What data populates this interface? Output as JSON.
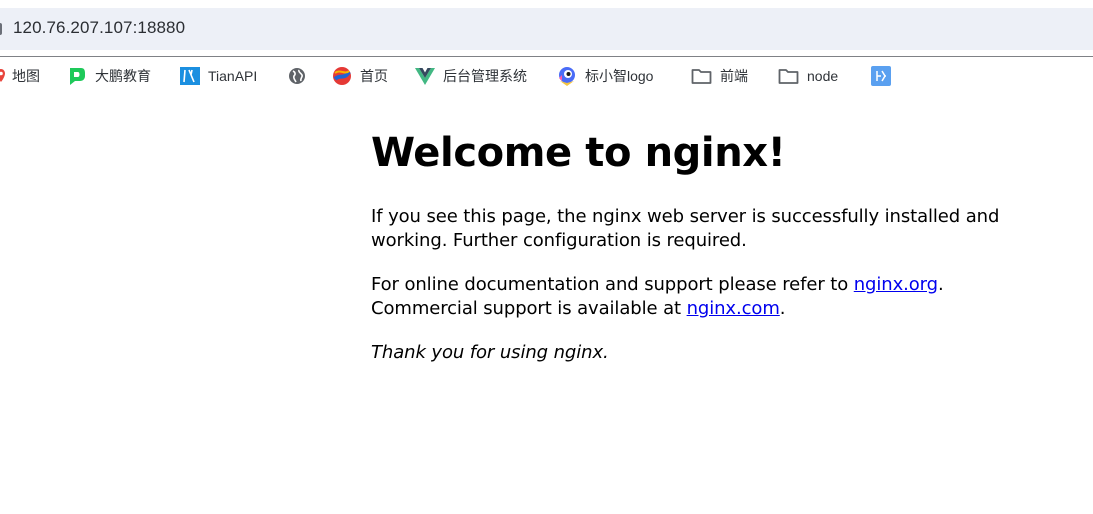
{
  "browser": {
    "address": "120.76.207.107:18880",
    "bookmarks": [
      {
        "label": "地图",
        "icon": "map-pin-icon",
        "color": "#e8453c"
      },
      {
        "label": "大鹏教育",
        "icon": "dapeng-logo-icon",
        "color": "#1ec95a"
      },
      {
        "label": "TianAPI",
        "icon": "tianapi-logo-icon",
        "color": "#1b8fe0"
      },
      {
        "label": "",
        "icon": "globe-icon",
        "color": "#5f6368"
      },
      {
        "label": "首页",
        "icon": "home-logo-icon",
        "color": "#e53935"
      },
      {
        "label": "后台管理系统",
        "icon": "vue-logo-icon",
        "color": "#42b883"
      },
      {
        "label": "标小智logo",
        "icon": "bird-logo-icon",
        "color": "#4a6cf7"
      },
      {
        "label": "前端",
        "icon": "folder-icon",
        "color": "#5f6368"
      },
      {
        "label": "node",
        "icon": "folder-icon",
        "color": "#5f6368"
      },
      {
        "label": "",
        "icon": "app-tile-icon",
        "color": "#5aa0f0"
      }
    ]
  },
  "page": {
    "title": "Welcome to nginx!",
    "p1": "If you see this page, the nginx web server is successfully installed and working. Further configuration is required.",
    "p2_prefix": "For online documentation and support please refer to ",
    "link_org": "nginx.org",
    "p2_mid": ".",
    "p2_line2": "Commercial support is available at ",
    "link_com": "nginx.com",
    "p2_end": ".",
    "p3": "Thank you for using nginx."
  }
}
